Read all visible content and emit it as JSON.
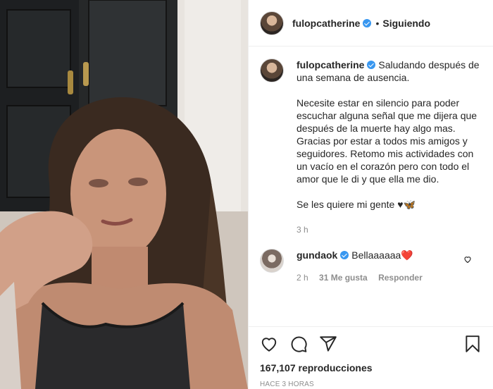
{
  "header": {
    "username": "fulopcatherine",
    "separator": "•",
    "follow_status": "Siguiendo"
  },
  "caption": {
    "username": "fulopcatherine",
    "line1": "Saludando después de una semana de ausencia.",
    "para2": "Necesite estar en silencio para poder escuchar alguna señal que me dijera que después de la muerte hay algo mas. Gracias por estar a todos mis amigos y seguidores. Retomo mis actividades con un vacío en el corazón pero con todo el amor que le di y que ella me dio.",
    "para3": "Se les quiere mi gente ♥🦋",
    "time": "3 h"
  },
  "comment": {
    "username": "gundaok",
    "text": "Bellaaaaaa❤️",
    "time": "2 h",
    "likes": "31 Me gusta",
    "reply_label": "Responder"
  },
  "footer": {
    "views_count": "167,107",
    "views_label": "reproducciones",
    "posted": "HACE 3 HORAS"
  },
  "icons": {
    "like": "heart-icon",
    "comment": "comment-icon",
    "share": "share-icon",
    "save": "bookmark-icon",
    "comment_like": "heart-small-icon"
  },
  "colors": {
    "verified": "#3897f0",
    "comment_heart": "#ed4956",
    "muted": "#8e8e8e"
  }
}
